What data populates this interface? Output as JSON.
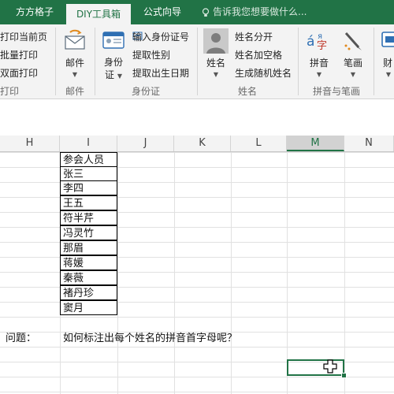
{
  "tabs": [
    {
      "label": "方方格子",
      "active": false
    },
    {
      "label": "DIY工具箱",
      "active": true
    },
    {
      "label": "公式向导",
      "active": false
    }
  ],
  "tell_me": "告诉我您想要做什么...",
  "ribbon": {
    "print_items": [
      "打印当前页",
      "批量打印",
      "双面打印"
    ],
    "print_group": "打印",
    "mail_button": "邮件",
    "mail_group": "邮件",
    "id_button_top": "身份",
    "id_button_bottom": "证",
    "id_items": [
      "输入身份证号",
      "提取性别",
      "提取出生日期"
    ],
    "id_group": "身份证",
    "name_button": "姓名",
    "name_items": [
      "姓名分开",
      "姓名加空格",
      "生成随机姓名"
    ],
    "name_group": "姓名",
    "pinyin_button": "拼音",
    "stroke_button": "笔画",
    "pinyin_group": "拼音与笔画",
    "cut_button": "财"
  },
  "columns": [
    "H",
    "I",
    "J",
    "K",
    "L",
    "M",
    "N"
  ],
  "selected_column": "M",
  "names": [
    "参会人员",
    "张三",
    "李四",
    "王五",
    "符半芹",
    "冯灵竹",
    "那眉",
    "蒋媛",
    "秦薇",
    "褚丹珍",
    "窦月"
  ],
  "question_label": "问题：",
  "question_text": "如何标注出每个姓名的拼音首字母呢？",
  "colors": {
    "accent": "#217346",
    "ribbon": "#f3f3f3",
    "border": "#000000"
  }
}
